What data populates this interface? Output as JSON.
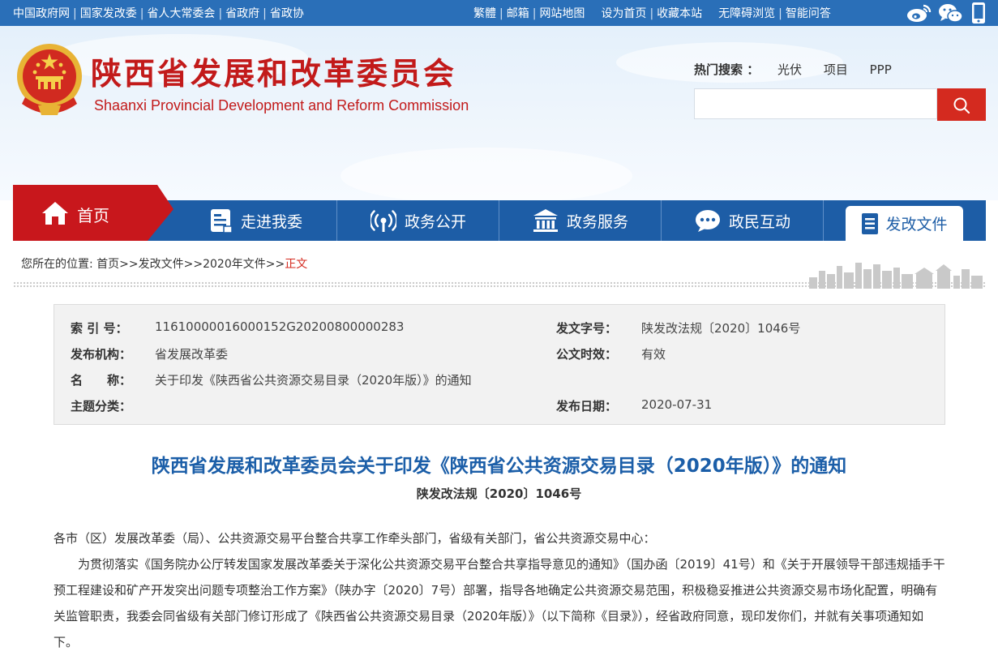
{
  "topbar": {
    "left_links": [
      "中国政府网",
      "国家发改委",
      "省人大常委会",
      "省政府",
      "省政协"
    ],
    "lang_links": [
      "繁體",
      "邮箱",
      "网站地图"
    ],
    "fav_links": [
      "设为首页",
      "收藏本站"
    ],
    "access_links": [
      "无障碍浏览",
      "智能问答"
    ],
    "social_icons": [
      "weibo-icon",
      "wechat-icon",
      "mobile-icon"
    ]
  },
  "header": {
    "title": "陕西省发展和改革委员会",
    "subtitle": "Shaanxi Provincial Development and Reform Commission",
    "hot_search_label": "热门搜索 ：",
    "hot_keywords": [
      "光伏",
      "项目",
      "PPP"
    ],
    "search_placeholder": ""
  },
  "nav": {
    "home": "首页",
    "items": [
      "走进我委",
      "政务公开",
      "政务服务",
      "政民互动"
    ],
    "active": "发改文件"
  },
  "breadcrumb": {
    "prefix": "您所在的位置:",
    "items": [
      "首页",
      "发改文件",
      "2020年文件"
    ],
    "separator": ">>",
    "current": "正文"
  },
  "meta": {
    "index_label": "索 引 号：",
    "index_value": "11610000016000152G20200800000283",
    "issuer_label": "发布机构：",
    "issuer_value": "省发展改革委",
    "name_label": "名　　称：",
    "name_value": "关于印发《陕西省公共资源交易目录（2020年版）》的通知",
    "topic_label": "主题分类：",
    "topic_value": "",
    "docno_label": "发文字号：",
    "docno_value": "陕发改法规〔2020〕1046号",
    "validity_label": "公文时效：",
    "validity_value": "有效",
    "date_label": "发布日期：",
    "date_value": "2020-07-31"
  },
  "article": {
    "title": "陕西省发展和改革委员会关于印发《陕西省公共资源交易目录（2020年版）》的通知",
    "doc_number": "陕发改法规〔2020〕1046号",
    "salutation": "各市（区）发展改革委（局）、公共资源交易平台整合共享工作牵头部门，省级有关部门，省公共资源交易中心：",
    "paragraph1": "为贯彻落实《国务院办公厅转发国家发展改革委关于深化公共资源交易平台整合共享指导意见的通知》（国办函〔2019〕41号）和《关于开展领导干部违规插手干预工程建设和矿产开发突出问题专项整治工作方案》（陕办字〔2020〕7号）部署，指导各地确定公共资源交易范围，积极稳妥推进公共资源交易市场化配置，明确有关监管职责，我委会同省级有关部门修订形成了《陕西省公共资源交易目录（2020年版）》（以下简称《目录》），经省政府同意，现印发你们，并就有关事项通知如下。"
  },
  "colors": {
    "topbar_bg": "#2a6fb8",
    "nav_bg": "#1d5da6",
    "brand_red": "#c21a1a",
    "title_blue": "#1b5ea8"
  }
}
